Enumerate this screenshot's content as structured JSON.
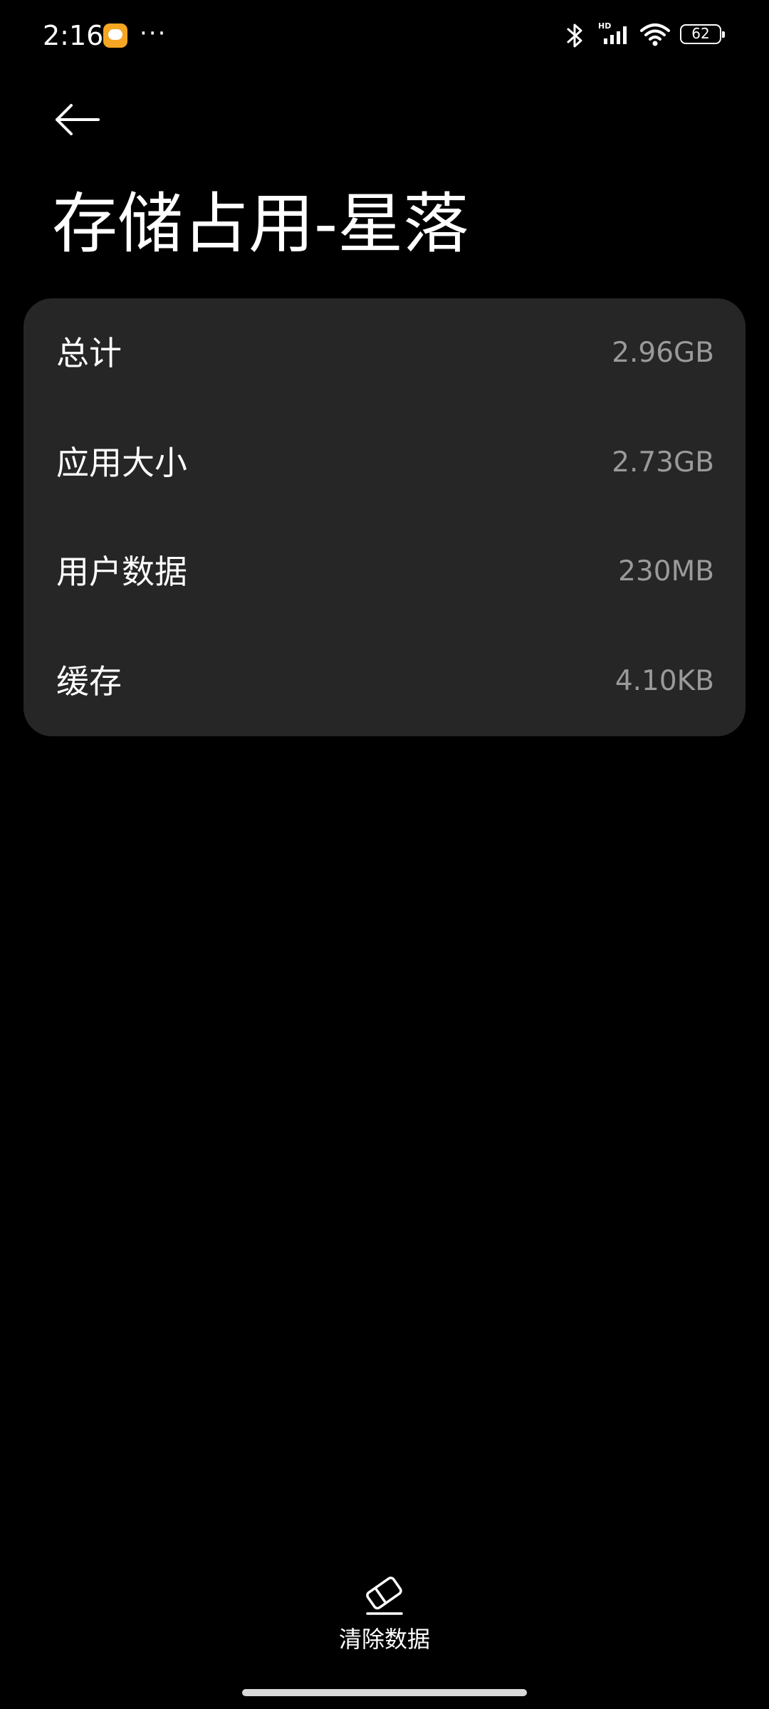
{
  "status_bar": {
    "time": "2:16",
    "notification_app_icon": "message-bubble-icon",
    "more_notifications": "···",
    "icons": [
      "bluetooth-icon",
      "hd-signal-icon",
      "wifi-icon",
      "battery-icon"
    ],
    "hd_label": "HD",
    "battery_level": "62"
  },
  "header": {
    "back_icon": "arrow-left-icon",
    "title": "存储占用-星落"
  },
  "storage": {
    "rows": [
      {
        "label": "总计",
        "value": "2.96GB"
      },
      {
        "label": "应用大小",
        "value": "2.73GB"
      },
      {
        "label": "用户数据",
        "value": "230MB"
      },
      {
        "label": "缓存",
        "value": "4.10KB"
      }
    ]
  },
  "bottom_action": {
    "icon": "eraser-icon",
    "label": "清除数据"
  },
  "colors": {
    "background": "#000000",
    "card": "#262626",
    "primary_text": "#ffffff",
    "secondary_text": "#9a9a9a"
  }
}
